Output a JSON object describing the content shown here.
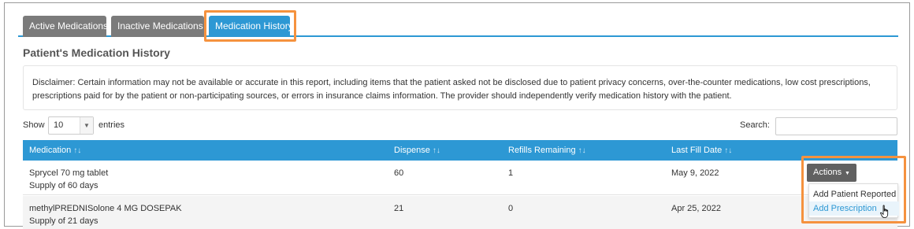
{
  "tabs": {
    "active": "Active Medications",
    "inactive": "Inactive Medications",
    "history": "Medication History"
  },
  "section_title": "Patient's Medication History",
  "disclaimer": "Disclaimer: Certain information may not be available or accurate in this report, including items that the patient asked not be disclosed due to patient privacy concerns, over-the-counter medications, low cost prescriptions, prescriptions paid for by the patient or non-participating sources, or errors in insurance claims information. The provider should independently verify medication history with the patient.",
  "length_control": {
    "show_label": "Show",
    "value": "10",
    "entries_label": "entries"
  },
  "search": {
    "label": "Search:",
    "value": ""
  },
  "table": {
    "headers": {
      "medication": "Medication",
      "dispense": "Dispense",
      "refills": "Refills Remaining",
      "last_fill": "Last Fill Date"
    },
    "sort_glyph": "↑↓",
    "rows": [
      {
        "name": "Sprycel 70 mg tablet",
        "supply": "Supply of 60 days",
        "dispense": "60",
        "refills": "1",
        "last_fill": "May 9, 2022"
      },
      {
        "name": "methylPREDNISolone 4 MG DOSEPAK",
        "supply": "Supply of 21 days",
        "dispense": "21",
        "refills": "0",
        "last_fill": "Apr 25, 2022"
      }
    ]
  },
  "actions": {
    "label": "Actions",
    "menu": [
      "Add Patient Reported",
      "Add Prescription"
    ]
  },
  "colors": {
    "accent": "#2d98d4",
    "tab_inactive": "#7b7b7b",
    "highlight": "#f5923e"
  }
}
